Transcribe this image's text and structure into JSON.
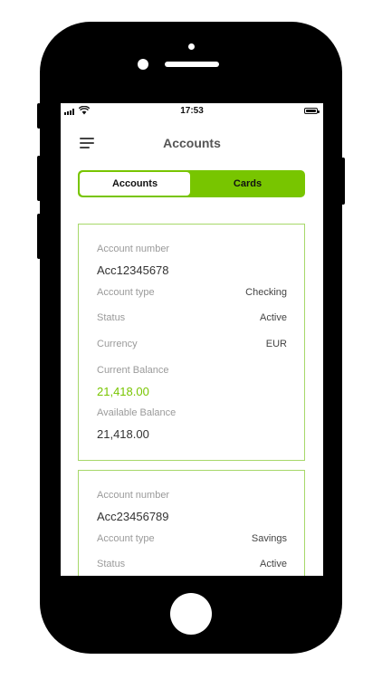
{
  "status_bar": {
    "time": "17:53"
  },
  "header": {
    "title": "Accounts"
  },
  "tabs": [
    {
      "label": "Accounts",
      "active": true
    },
    {
      "label": "Cards",
      "active": false
    }
  ],
  "accounts": [
    {
      "account_number_label": "Account number",
      "account_number": "Acc12345678",
      "account_type_label": "Account type",
      "account_type": "Checking",
      "status_label": "Status",
      "status": "Active",
      "currency_label": "Currency",
      "currency": "EUR",
      "current_balance_label": "Current Balance",
      "current_balance": "21,418.00",
      "available_balance_label": "Available Balance",
      "available_balance": "21,418.00"
    },
    {
      "account_number_label": "Account number",
      "account_number": "Acc23456789",
      "account_type_label": "Account type",
      "account_type": "Savings",
      "status_label": "Status",
      "status": "Active"
    }
  ],
  "colors": {
    "accent": "#78c500",
    "card_border": "#a7d86a",
    "phone_frame": "#000000"
  },
  "icons": [
    "hamburger-menu-icon",
    "signal-icon",
    "wifi-icon",
    "battery-icon"
  ]
}
